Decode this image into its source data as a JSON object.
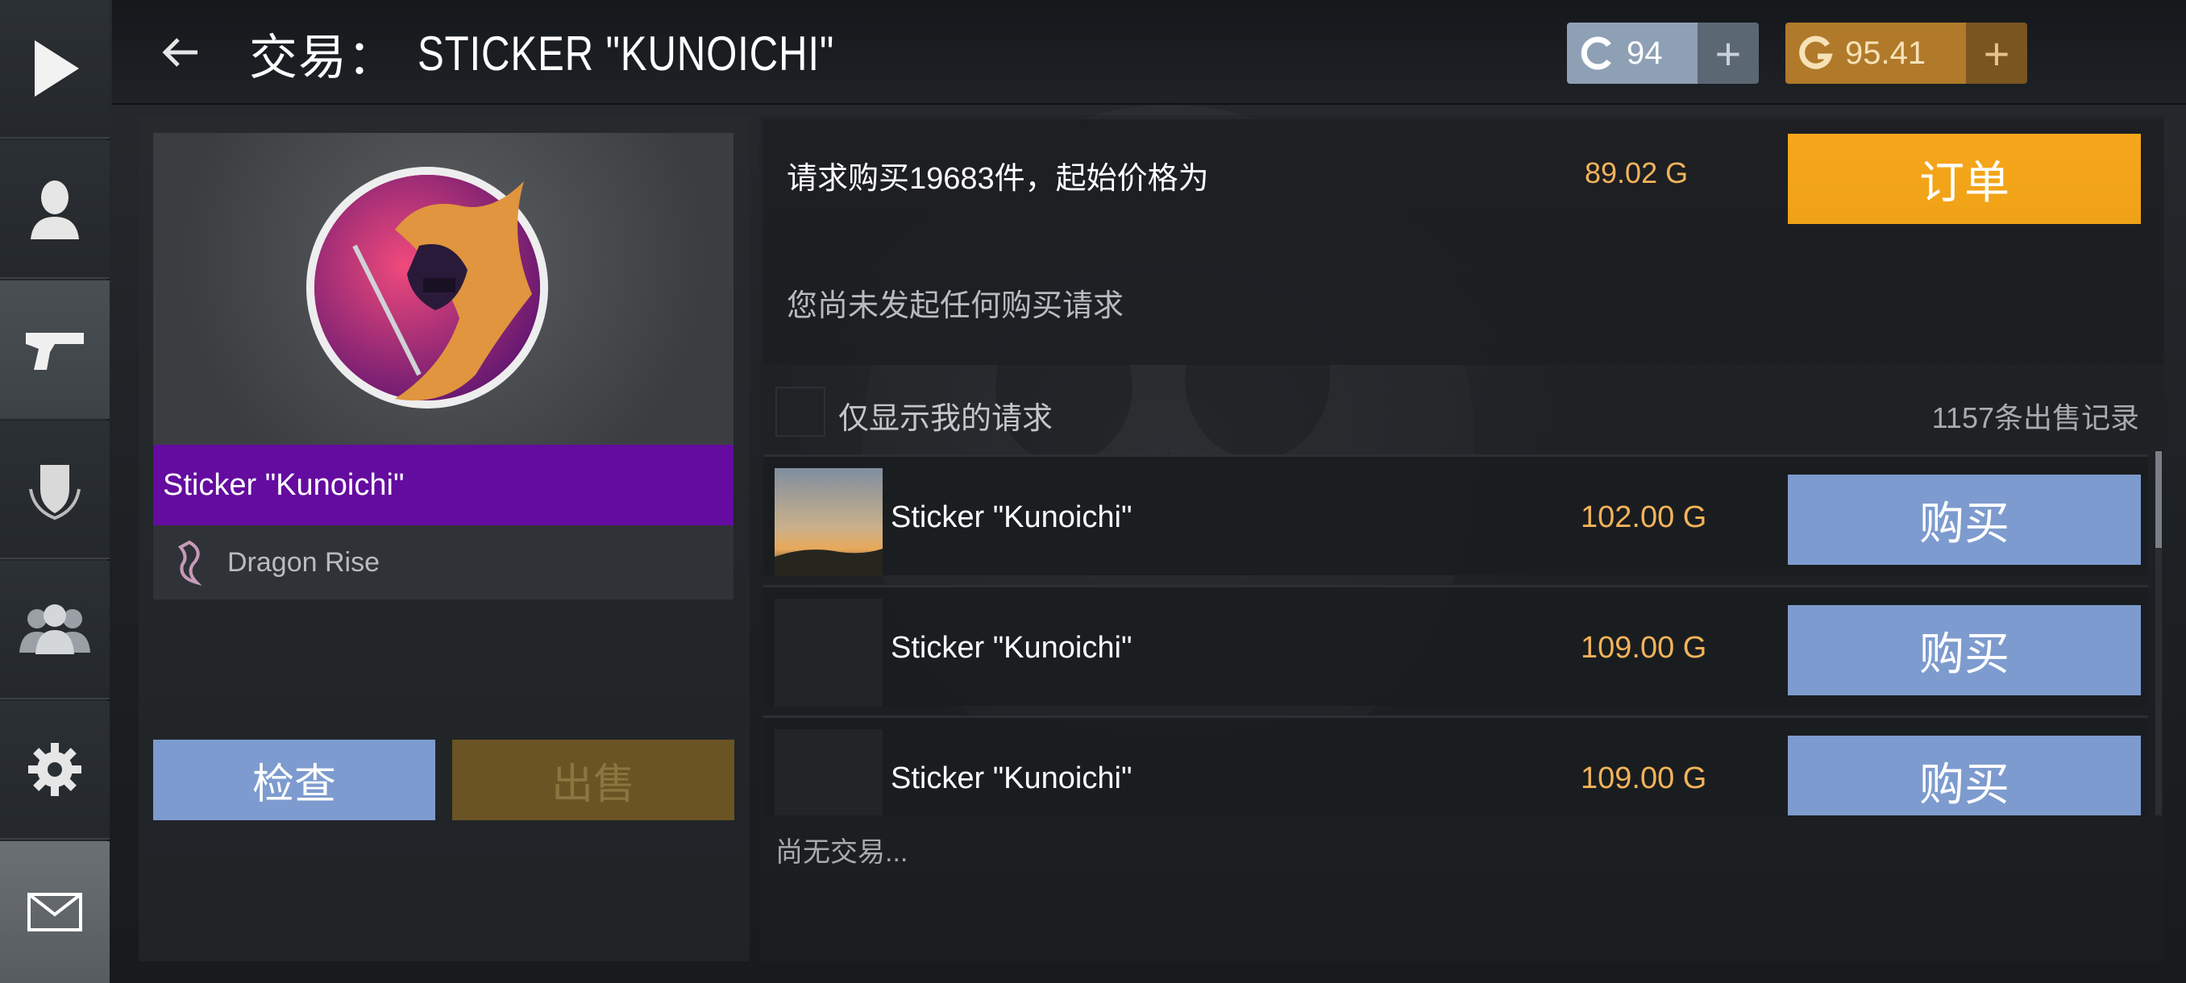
{
  "header": {
    "title_prefix": "交易：",
    "title_item": "STICKER \"KUNOICHI\"",
    "currency_c": {
      "value": "94",
      "plus": "+"
    },
    "currency_g": {
      "value": "95.41",
      "plus": "+"
    }
  },
  "sidebar": {
    "items": [
      {
        "name": "play-icon"
      },
      {
        "name": "profile-icon"
      },
      {
        "name": "pistol-icon"
      },
      {
        "name": "clan-shield-icon"
      },
      {
        "name": "friends-icon"
      },
      {
        "name": "gear-icon"
      },
      {
        "name": "mail-icon"
      }
    ]
  },
  "item": {
    "name": "Sticker \"Kunoichi\"",
    "collection": "Dragon Rise",
    "inspect_label": "检查",
    "sell_label": "出售",
    "rarity_color": "#640ba0"
  },
  "request": {
    "text": "请求购买19683件，起始价格为",
    "price": "89.02 G",
    "order_label": "订单",
    "no_request_text": "您尚未发起任何购买请求"
  },
  "listing": {
    "filter_label": "仅显示我的请求",
    "sale_count": "1157条出售记录",
    "rows": [
      {
        "name": "Sticker \"Kunoichi\"",
        "price": "102.00 G",
        "buy_label": "购买"
      },
      {
        "name": "Sticker \"Kunoichi\"",
        "price": "109.00 G",
        "buy_label": "购买"
      },
      {
        "name": "Sticker \"Kunoichi\"",
        "price": "109.00 G",
        "buy_label": "购买"
      }
    ],
    "no_trade_text": "尚无交易..."
  },
  "colors": {
    "accent_orange": "#f0a216",
    "price_gold": "#f3b35a",
    "button_blue": "#7d9bce"
  }
}
